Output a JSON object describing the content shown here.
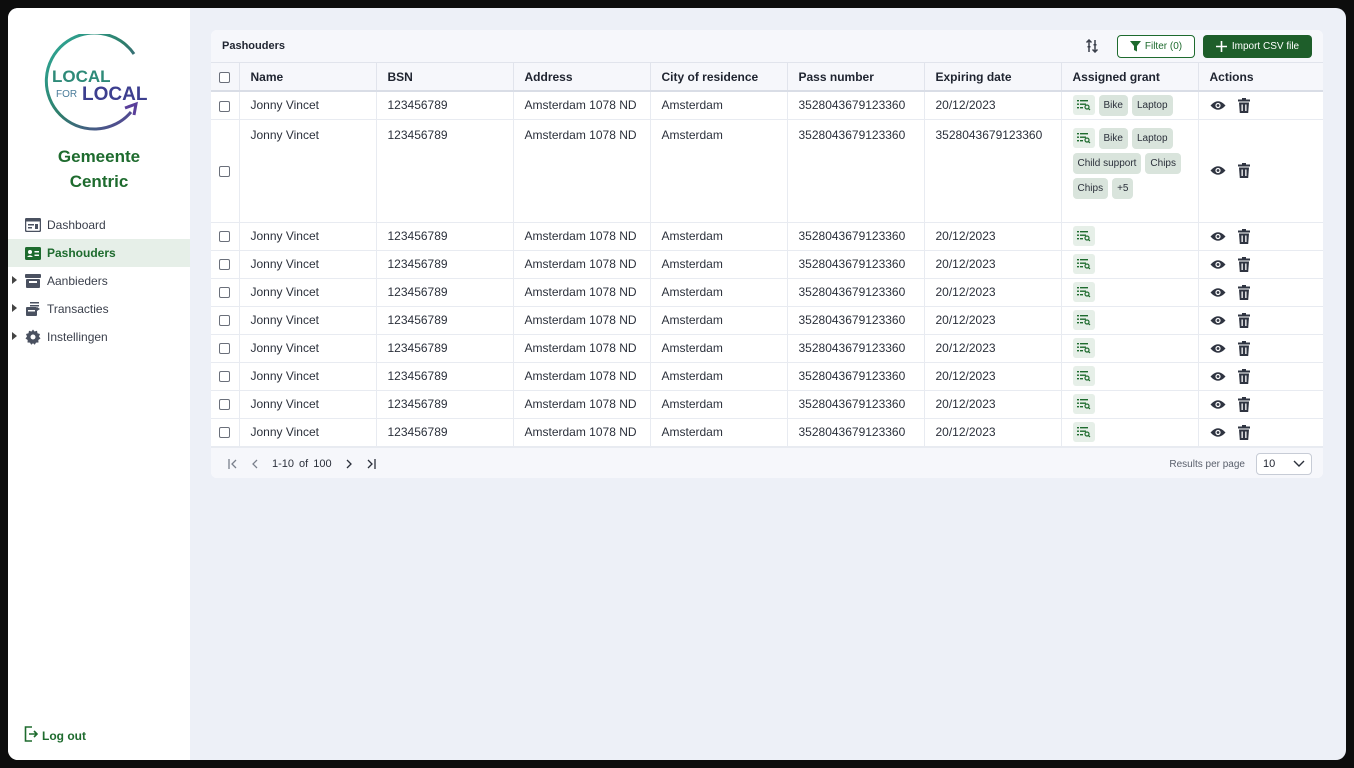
{
  "brand": {
    "logo_line1": "LOCAL",
    "logo_line2_small": "FOR",
    "logo_line2_big": "LOCAL",
    "org_name_line1": "Gemeente",
    "org_name_line2": "Centric",
    "primary_color": "#1e6b2e"
  },
  "sidebar": {
    "items": [
      {
        "label": "Dashboard",
        "icon": "dashboard-icon",
        "expandable": false,
        "active": false
      },
      {
        "label": "Pashouders",
        "icon": "id-card-icon",
        "expandable": false,
        "active": true
      },
      {
        "label": "Aanbieders",
        "icon": "store-icon",
        "expandable": true,
        "active": false
      },
      {
        "label": "Transacties",
        "icon": "transactions-icon",
        "expandable": true,
        "active": false
      },
      {
        "label": "Instellingen",
        "icon": "gear-icon",
        "expandable": true,
        "active": false
      }
    ],
    "logout_label": "Log out"
  },
  "header": {
    "title": "Pashouders",
    "filter_label": "Filter (0)",
    "import_label": "Import CSV file"
  },
  "table": {
    "columns": [
      "Name",
      "BSN",
      "Address",
      "City of residence",
      "Pass number",
      "Expiring date",
      "Assigned grant",
      "Actions"
    ],
    "rows": [
      {
        "name": "Jonny Vincet",
        "bsn": "123456789",
        "address": "Amsterdam 1078 ND",
        "city": "Amsterdam",
        "pass": "3528043679123360",
        "expiring": "20/12/2023",
        "grants": [
          "Bike",
          "Laptop"
        ]
      },
      {
        "name": "Jonny Vincet",
        "bsn": "123456789",
        "address": "Amsterdam 1078 ND",
        "city": "Amsterdam",
        "pass": "3528043679123360",
        "expiring": "3528043679123360",
        "grants": [
          "Bike",
          "Laptop",
          "Child support",
          "Chips",
          "Chips",
          "+5"
        ]
      },
      {
        "name": "Jonny Vincet",
        "bsn": "123456789",
        "address": "Amsterdam 1078 ND",
        "city": "Amsterdam",
        "pass": "3528043679123360",
        "expiring": "20/12/2023",
        "grants": []
      },
      {
        "name": "Jonny Vincet",
        "bsn": "123456789",
        "address": "Amsterdam 1078 ND",
        "city": "Amsterdam",
        "pass": "3528043679123360",
        "expiring": "20/12/2023",
        "grants": []
      },
      {
        "name": "Jonny Vincet",
        "bsn": "123456789",
        "address": "Amsterdam 1078 ND",
        "city": "Amsterdam",
        "pass": "3528043679123360",
        "expiring": "20/12/2023",
        "grants": []
      },
      {
        "name": "Jonny Vincet",
        "bsn": "123456789",
        "address": "Amsterdam 1078 ND",
        "city": "Amsterdam",
        "pass": "3528043679123360",
        "expiring": "20/12/2023",
        "grants": []
      },
      {
        "name": "Jonny Vincet",
        "bsn": "123456789",
        "address": "Amsterdam 1078 ND",
        "city": "Amsterdam",
        "pass": "3528043679123360",
        "expiring": "20/12/2023",
        "grants": []
      },
      {
        "name": "Jonny Vincet",
        "bsn": "123456789",
        "address": "Amsterdam 1078 ND",
        "city": "Amsterdam",
        "pass": "3528043679123360",
        "expiring": "20/12/2023",
        "grants": []
      },
      {
        "name": "Jonny Vincet",
        "bsn": "123456789",
        "address": "Amsterdam 1078 ND",
        "city": "Amsterdam",
        "pass": "3528043679123360",
        "expiring": "20/12/2023",
        "grants": []
      },
      {
        "name": "Jonny Vincet",
        "bsn": "123456789",
        "address": "Amsterdam 1078 ND",
        "city": "Amsterdam",
        "pass": "3528043679123360",
        "expiring": "20/12/2023",
        "grants": []
      }
    ]
  },
  "pagination": {
    "range": "1-10",
    "of": "of",
    "total": "100",
    "rpp_label": "Results per page",
    "rpp_value": "10"
  }
}
